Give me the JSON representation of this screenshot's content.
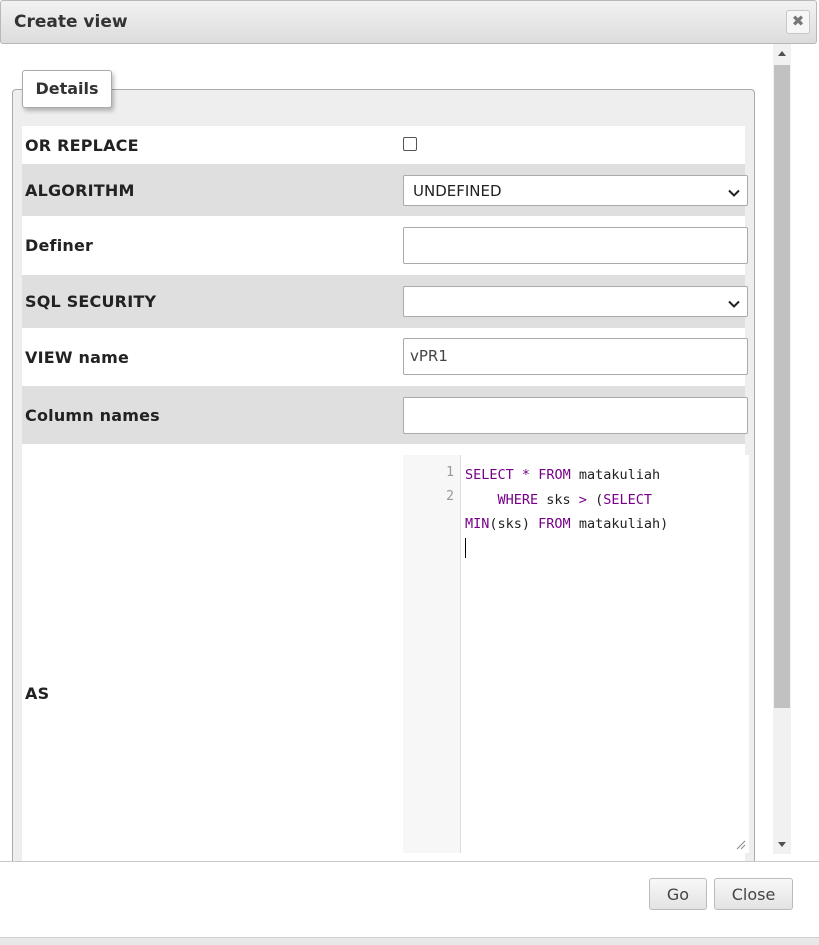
{
  "dialog": {
    "title": "Create view",
    "close_icon": "close-icon",
    "tab_label": "Details"
  },
  "form": {
    "or_replace": {
      "label": "OR REPLACE",
      "checked": false
    },
    "algorithm": {
      "label": "ALGORITHM",
      "value": "UNDEFINED"
    },
    "definer": {
      "label": "Definer",
      "value": ""
    },
    "sql_security": {
      "label": "SQL SECURITY",
      "value": ""
    },
    "view_name": {
      "label": "VIEW name",
      "value": "vPR1"
    },
    "column_names": {
      "label": "Column names",
      "value": ""
    },
    "as": {
      "label": "AS",
      "line_numbers": [
        "1",
        "2"
      ],
      "code_lines": [
        [
          {
            "t": "SELECT",
            "c": "kw"
          },
          {
            "t": " "
          },
          {
            "t": "*",
            "c": "kw"
          },
          {
            "t": " "
          },
          {
            "t": "FROM",
            "c": "kw"
          },
          {
            "t": " matakuliah"
          }
        ],
        [
          {
            "t": "    "
          },
          {
            "t": "WHERE",
            "c": "kw"
          },
          {
            "t": " sks "
          },
          {
            "t": ">",
            "c": "kw"
          },
          {
            "t": " ("
          },
          {
            "t": "SELECT",
            "c": "kw"
          }
        ],
        [
          {
            "t": "MIN",
            "c": "kw"
          },
          {
            "t": "(sks) "
          },
          {
            "t": "FROM",
            "c": "kw"
          },
          {
            "t": " matakuliah)"
          }
        ]
      ]
    }
  },
  "footer": {
    "go_label": "Go",
    "close_label": "Close"
  }
}
